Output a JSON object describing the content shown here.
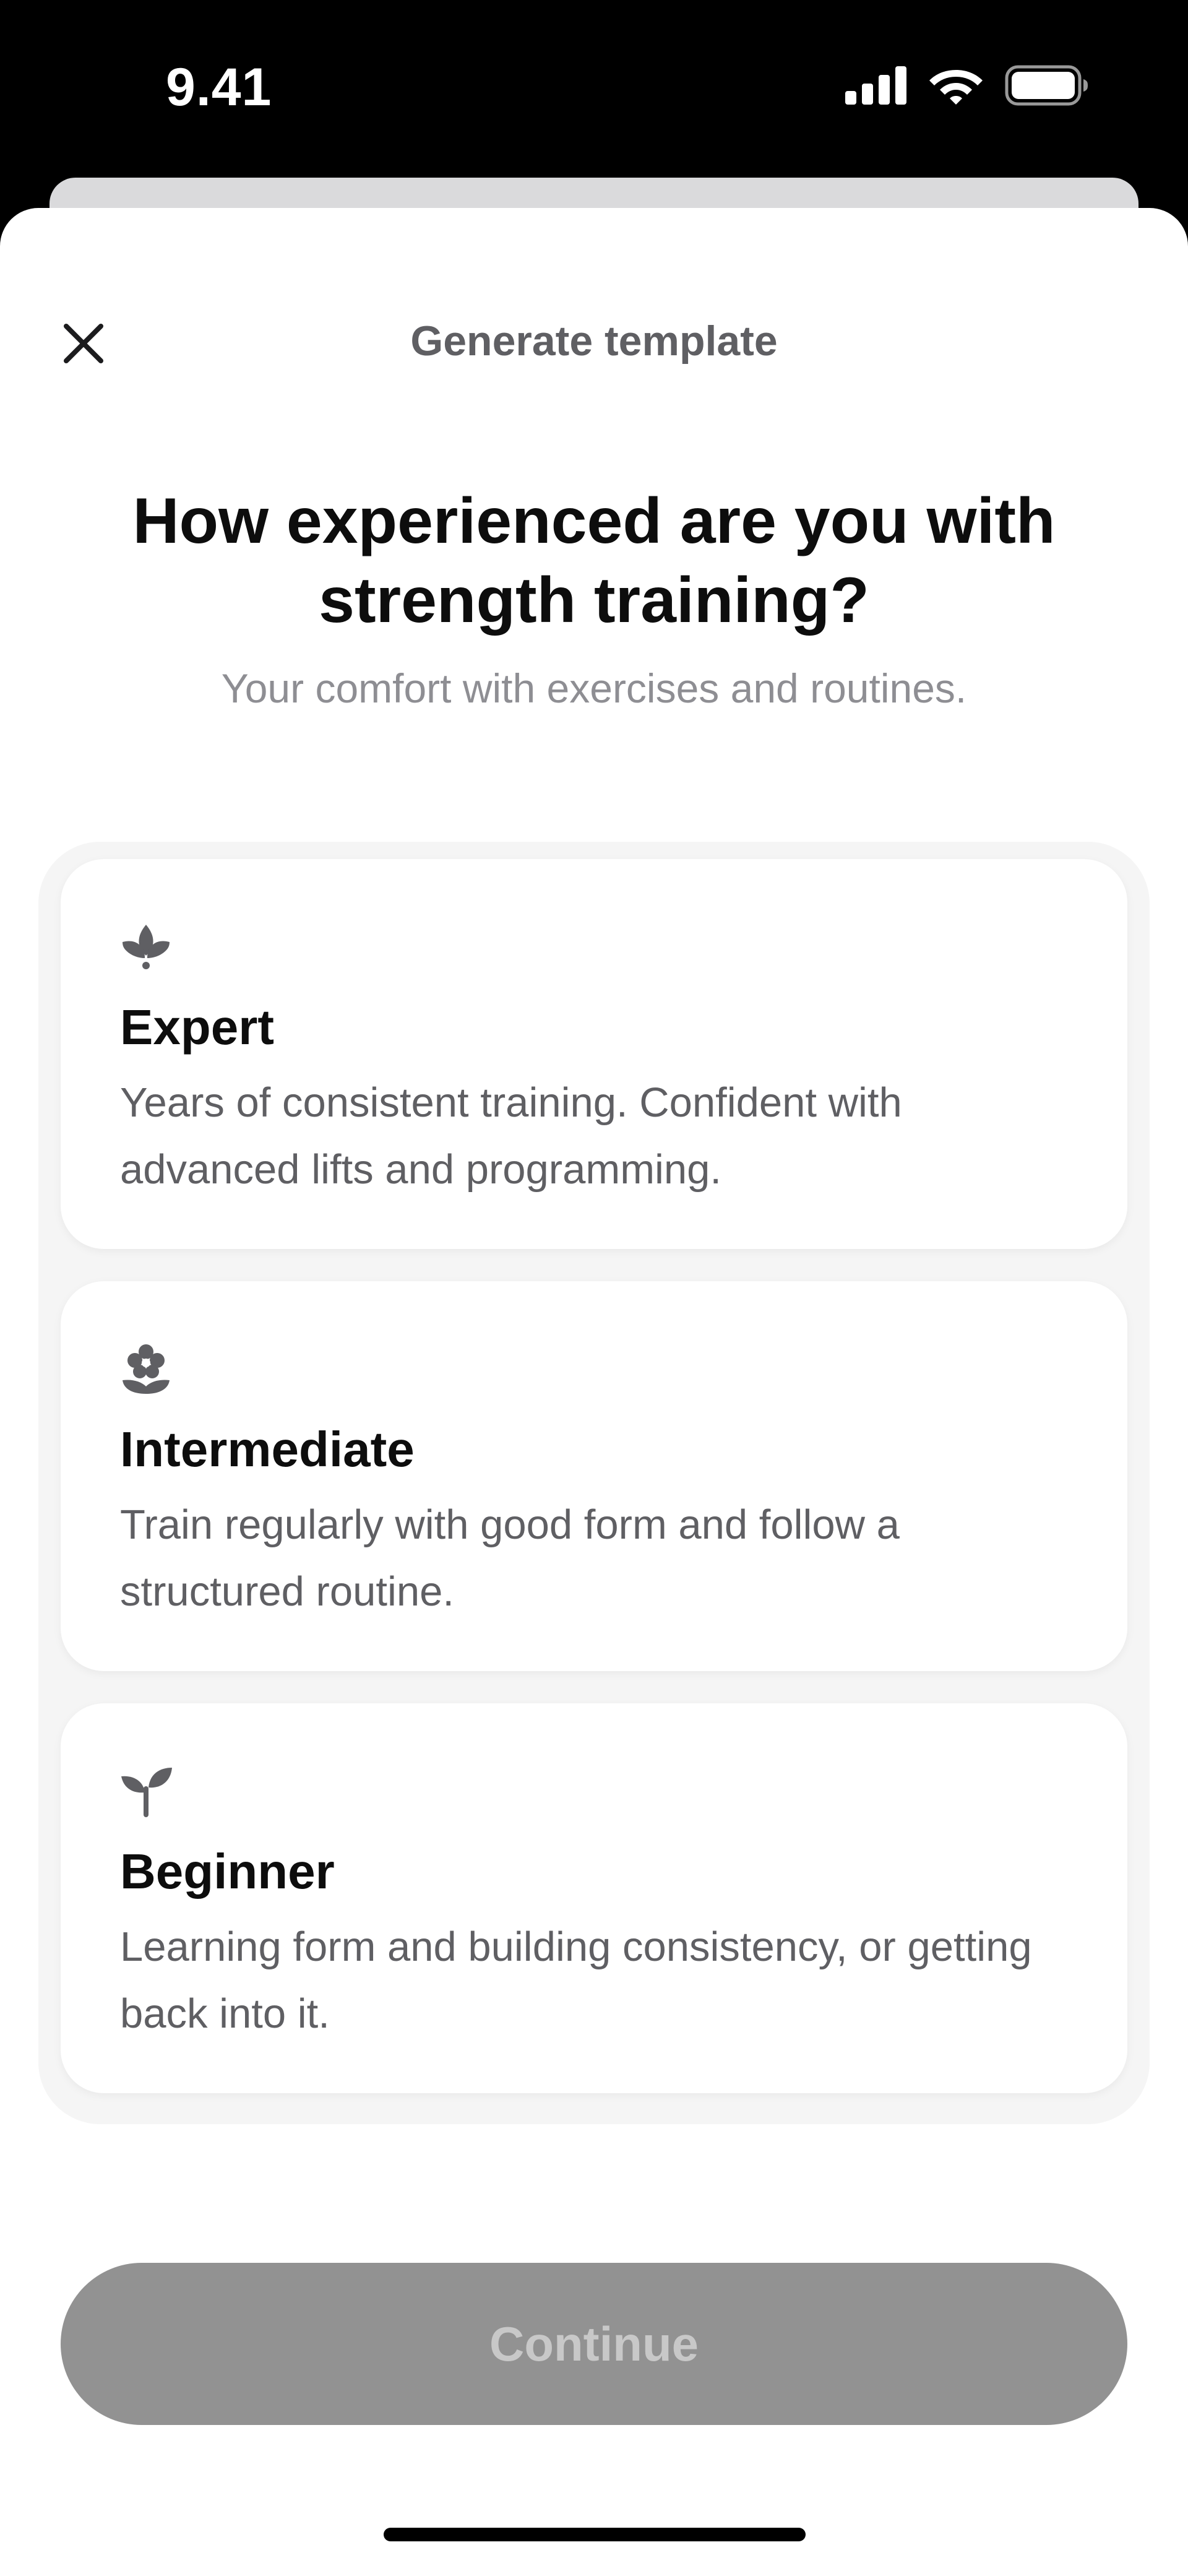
{
  "status_bar": {
    "time": "9.41",
    "icons": [
      "cellular-signal-icon",
      "wifi-icon",
      "battery-icon"
    ]
  },
  "header": {
    "title": "Generate template",
    "close_icon": "close-icon"
  },
  "question": {
    "title": "How experienced are you with strength training?",
    "subtitle": "Your comfort with exercises and routines."
  },
  "options": [
    {
      "icon": "lotus-icon",
      "title": "Expert",
      "description": "Years of consistent training. Confident with advanced lifts and programming."
    },
    {
      "icon": "flower-icon",
      "title": "Intermediate",
      "description": "Train regularly with good form and follow a structured routine."
    },
    {
      "icon": "sprout-icon",
      "title": "Beginner",
      "description": "Learning form and building consistency, or getting back into it."
    }
  ],
  "footer": {
    "continue_label": "Continue",
    "continue_state": "disabled"
  },
  "colors": {
    "text_primary": "#0d0d0d",
    "text_secondary": "#5f5f63",
    "text_muted": "#8e8e93",
    "button_disabled_bg": "#929292",
    "button_disabled_text": "#c8c8c8",
    "group_bg": "#f5f5f5"
  }
}
